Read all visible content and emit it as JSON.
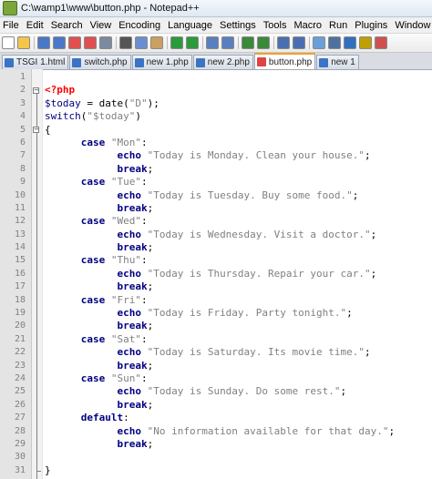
{
  "window": {
    "title": "C:\\wamp1\\www\\button.php - Notepad++"
  },
  "menu": [
    "File",
    "Edit",
    "Search",
    "View",
    "Encoding",
    "Language",
    "Settings",
    "Tools",
    "Macro",
    "Run",
    "Plugins",
    "Window"
  ],
  "toolbar_icons": [
    "new-file-icon",
    "open-file-icon",
    "save-icon",
    "save-all-icon",
    "close-icon",
    "close-all-icon",
    "print-icon",
    "cut-icon",
    "copy-icon",
    "paste-icon",
    "undo-icon",
    "redo-icon",
    "find-icon",
    "replace-icon",
    "zoom-in-icon",
    "zoom-out-icon",
    "sync-v-icon",
    "sync-h-icon",
    "wrap-icon",
    "all-chars-icon",
    "indent-guide-icon",
    "bookmark-icon",
    "macro-icon"
  ],
  "tabs": [
    {
      "label": "TSGI 1.html",
      "active": false
    },
    {
      "label": "switch.php",
      "active": false
    },
    {
      "label": "new 1.php",
      "active": false
    },
    {
      "label": "new 2.php",
      "active": false
    },
    {
      "label": "button.php",
      "active": true
    },
    {
      "label": "new 1",
      "active": false
    }
  ],
  "code_lines": [
    [],
    [
      {
        "t": "<?php",
        "c": "tag"
      }
    ],
    [
      {
        "t": "$today",
        "c": "var"
      },
      {
        "t": " = date(",
        "c": "plain"
      },
      {
        "t": "\"D\"",
        "c": "str"
      },
      {
        "t": ");",
        "c": "plain"
      }
    ],
    [
      {
        "t": "switch",
        "c": "var"
      },
      {
        "t": "(",
        "c": "plain"
      },
      {
        "t": "\"$today\"",
        "c": "str"
      },
      {
        "t": ")",
        "c": "plain"
      }
    ],
    [
      {
        "t": "{",
        "c": "plain"
      }
    ],
    [
      {
        "t": "      case ",
        "c": "kw"
      },
      {
        "t": "\"Mon\"",
        "c": "str"
      },
      {
        "t": ":",
        "c": "plain"
      }
    ],
    [
      {
        "t": "            echo ",
        "c": "kw"
      },
      {
        "t": "\"Today is Monday. Clean your house.\"",
        "c": "str"
      },
      {
        "t": ";",
        "c": "plain"
      }
    ],
    [
      {
        "t": "            break",
        "c": "kw"
      },
      {
        "t": ";",
        "c": "plain"
      }
    ],
    [
      {
        "t": "      case ",
        "c": "kw"
      },
      {
        "t": "\"Tue\"",
        "c": "str"
      },
      {
        "t": ":",
        "c": "plain"
      }
    ],
    [
      {
        "t": "            echo ",
        "c": "kw"
      },
      {
        "t": "\"Today is Tuesday. Buy some food.\"",
        "c": "str"
      },
      {
        "t": ";",
        "c": "plain"
      }
    ],
    [
      {
        "t": "            break",
        "c": "kw"
      },
      {
        "t": ";",
        "c": "plain"
      }
    ],
    [
      {
        "t": "      case ",
        "c": "kw"
      },
      {
        "t": "\"Wed\"",
        "c": "str"
      },
      {
        "t": ":",
        "c": "plain"
      }
    ],
    [
      {
        "t": "            echo ",
        "c": "kw"
      },
      {
        "t": "\"Today is Wednesday. Visit a doctor.\"",
        "c": "str"
      },
      {
        "t": ";",
        "c": "plain"
      }
    ],
    [
      {
        "t": "            break",
        "c": "kw"
      },
      {
        "t": ";",
        "c": "plain"
      }
    ],
    [
      {
        "t": "      case ",
        "c": "kw"
      },
      {
        "t": "\"Thu\"",
        "c": "str"
      },
      {
        "t": ":",
        "c": "plain"
      }
    ],
    [
      {
        "t": "            echo ",
        "c": "kw"
      },
      {
        "t": "\"Today is Thursday. Repair your car.\"",
        "c": "str"
      },
      {
        "t": ";",
        "c": "plain"
      }
    ],
    [
      {
        "t": "            break",
        "c": "kw"
      },
      {
        "t": ";",
        "c": "plain"
      }
    ],
    [
      {
        "t": "      case ",
        "c": "kw"
      },
      {
        "t": "\"Fri\"",
        "c": "str"
      },
      {
        "t": ":",
        "c": "plain"
      }
    ],
    [
      {
        "t": "            echo ",
        "c": "kw"
      },
      {
        "t": "\"Today is Friday. Party tonight.\"",
        "c": "str"
      },
      {
        "t": ";",
        "c": "plain"
      }
    ],
    [
      {
        "t": "            break",
        "c": "kw"
      },
      {
        "t": ";",
        "c": "plain"
      }
    ],
    [
      {
        "t": "      case ",
        "c": "kw"
      },
      {
        "t": "\"Sat\"",
        "c": "str"
      },
      {
        "t": ":",
        "c": "plain"
      }
    ],
    [
      {
        "t": "            echo ",
        "c": "kw"
      },
      {
        "t": "\"Today is Saturday. Its movie time.\"",
        "c": "str"
      },
      {
        "t": ";",
        "c": "plain"
      }
    ],
    [
      {
        "t": "            break",
        "c": "kw"
      },
      {
        "t": ";",
        "c": "plain"
      }
    ],
    [
      {
        "t": "      case ",
        "c": "kw"
      },
      {
        "t": "\"Sun\"",
        "c": "str"
      },
      {
        "t": ":",
        "c": "plain"
      }
    ],
    [
      {
        "t": "            echo ",
        "c": "kw"
      },
      {
        "t": "\"Today is Sunday. Do some rest.\"",
        "c": "str"
      },
      {
        "t": ";",
        "c": "plain"
      }
    ],
    [
      {
        "t": "            break",
        "c": "kw"
      },
      {
        "t": ";",
        "c": "plain"
      }
    ],
    [
      {
        "t": "      default",
        "c": "kw"
      },
      {
        "t": ":",
        "c": "plain"
      }
    ],
    [
      {
        "t": "            echo ",
        "c": "kw"
      },
      {
        "t": "\"No information available for that day.\"",
        "c": "str"
      },
      {
        "t": ";",
        "c": "plain"
      }
    ],
    [
      {
        "t": "            break",
        "c": "kw"
      },
      {
        "t": ";",
        "c": "plain"
      }
    ],
    [],
    [
      {
        "t": "}",
        "c": "plain"
      }
    ],
    [
      {
        "t": "?>",
        "c": "tag"
      }
    ]
  ]
}
